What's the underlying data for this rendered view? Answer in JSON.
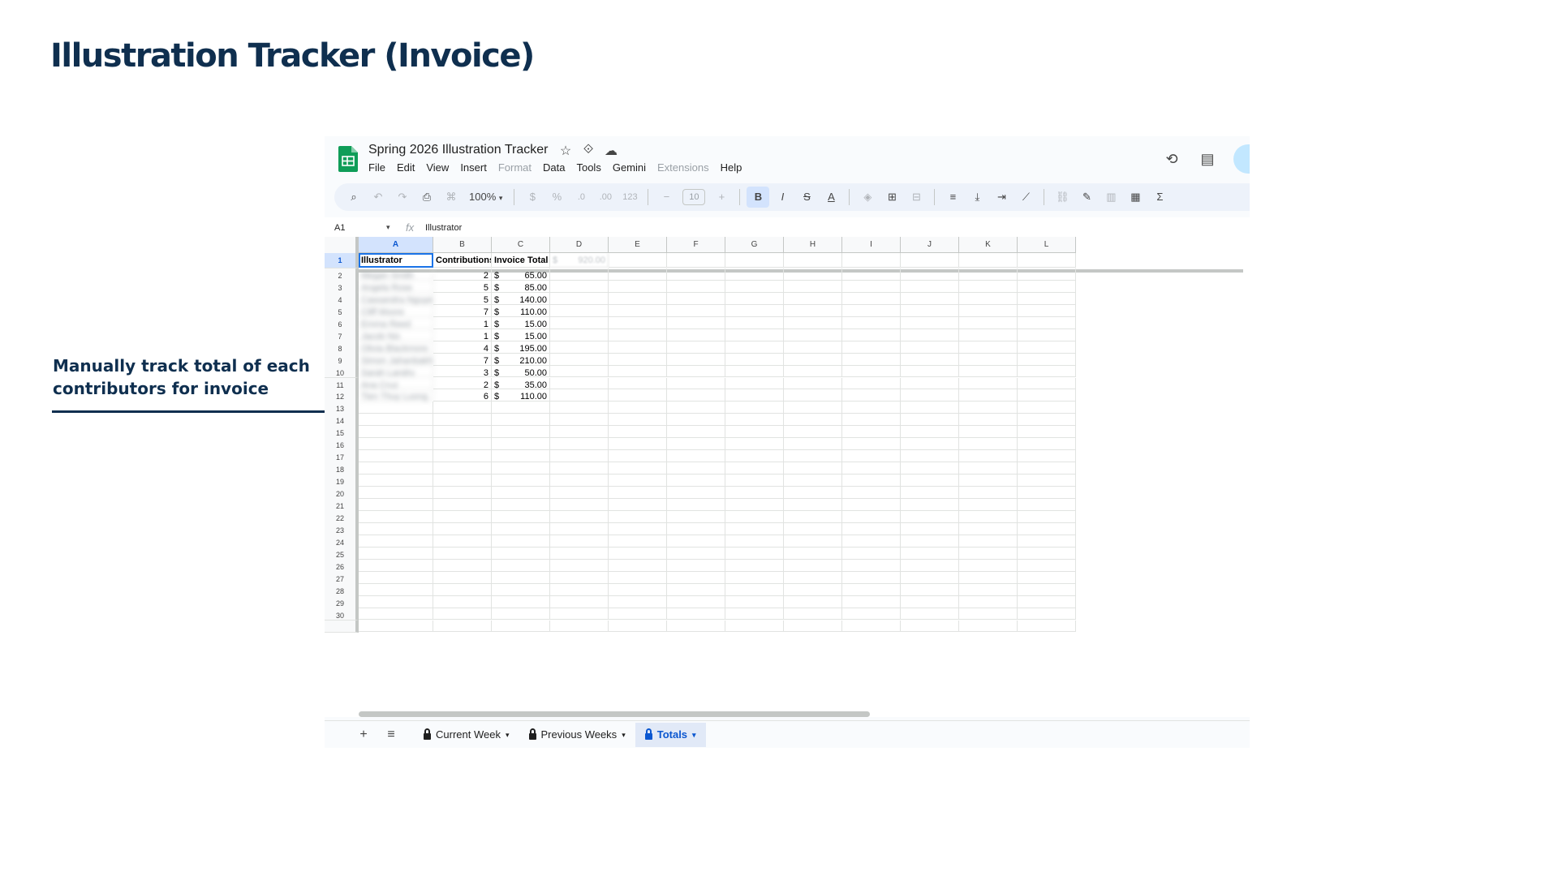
{
  "slide": {
    "title": "Illustration Tracker (Invoice)",
    "callout": "Manually track total of each contributors for invoice"
  },
  "app": {
    "doc_title": "Spring 2026 Illustration Tracker",
    "menu": [
      {
        "label": "File",
        "disabled": false
      },
      {
        "label": "Edit",
        "disabled": false
      },
      {
        "label": "View",
        "disabled": false
      },
      {
        "label": "Insert",
        "disabled": false
      },
      {
        "label": "Format",
        "disabled": true
      },
      {
        "label": "Data",
        "disabled": false
      },
      {
        "label": "Tools",
        "disabled": false
      },
      {
        "label": "Gemini",
        "disabled": false
      },
      {
        "label": "Extensions",
        "disabled": true
      },
      {
        "label": "Help",
        "disabled": false
      }
    ]
  },
  "toolbar": {
    "zoom": "100%",
    "currency": "$",
    "percent": "%",
    "dec_decrease": ".0",
    "dec_increase": ".00",
    "number_format": "123",
    "font_size": "10",
    "bold": "B",
    "italic": "I",
    "sum": "Σ"
  },
  "formula_bar": {
    "cell_ref": "A1",
    "value": "Illustrator"
  },
  "grid": {
    "columns": [
      "A",
      "B",
      "C",
      "D",
      "E",
      "F",
      "G",
      "H",
      "I",
      "J",
      "K",
      "L"
    ],
    "header": [
      "Illustrator",
      "Contributions",
      "Invoice Total"
    ],
    "faded_d1": {
      "currency": "$",
      "value": "920.00"
    },
    "currency_symbol": "$",
    "rows": [
      {
        "name": "Megan Smith",
        "contributions": 2,
        "total": "65.00"
      },
      {
        "name": "Angela Rose",
        "contributions": 5,
        "total": "85.00"
      },
      {
        "name": "Cassandra Nguyen",
        "contributions": 5,
        "total": "140.00"
      },
      {
        "name": "Cliff Moore",
        "contributions": 7,
        "total": "110.00"
      },
      {
        "name": "Emma Reed",
        "contributions": 1,
        "total": "15.00"
      },
      {
        "name": "Jacob Nix",
        "contributions": 1,
        "total": "15.00"
      },
      {
        "name": "Olivia Blackmore",
        "contributions": 4,
        "total": "195.00"
      },
      {
        "name": "Simon Jahanbakhsh",
        "contributions": 7,
        "total": "210.00"
      },
      {
        "name": "Sarah Landry",
        "contributions": 3,
        "total": "50.00"
      },
      {
        "name": "Ana Cruz",
        "contributions": 2,
        "total": "35.00"
      },
      {
        "name": "Tien Thuy Luong",
        "contributions": 6,
        "total": "110.00"
      }
    ],
    "total_rows": 30
  },
  "sheet_tabs": [
    {
      "label": "Current Week",
      "locked": true,
      "active": false
    },
    {
      "label": "Previous Weeks",
      "locked": true,
      "active": false
    },
    {
      "label": "Totals",
      "locked": true,
      "active": true
    }
  ],
  "icons": {
    "star": "star-icon",
    "move": "move-to-drive-icon",
    "cloud": "cloud-status-icon",
    "history": "version-history-icon",
    "comments": "comments-icon"
  },
  "colors": {
    "title": "#0f2f4f",
    "sheets_green": "#0f9d58",
    "selection_blue": "#1a73e8",
    "active_tab": "#0b57d0"
  }
}
